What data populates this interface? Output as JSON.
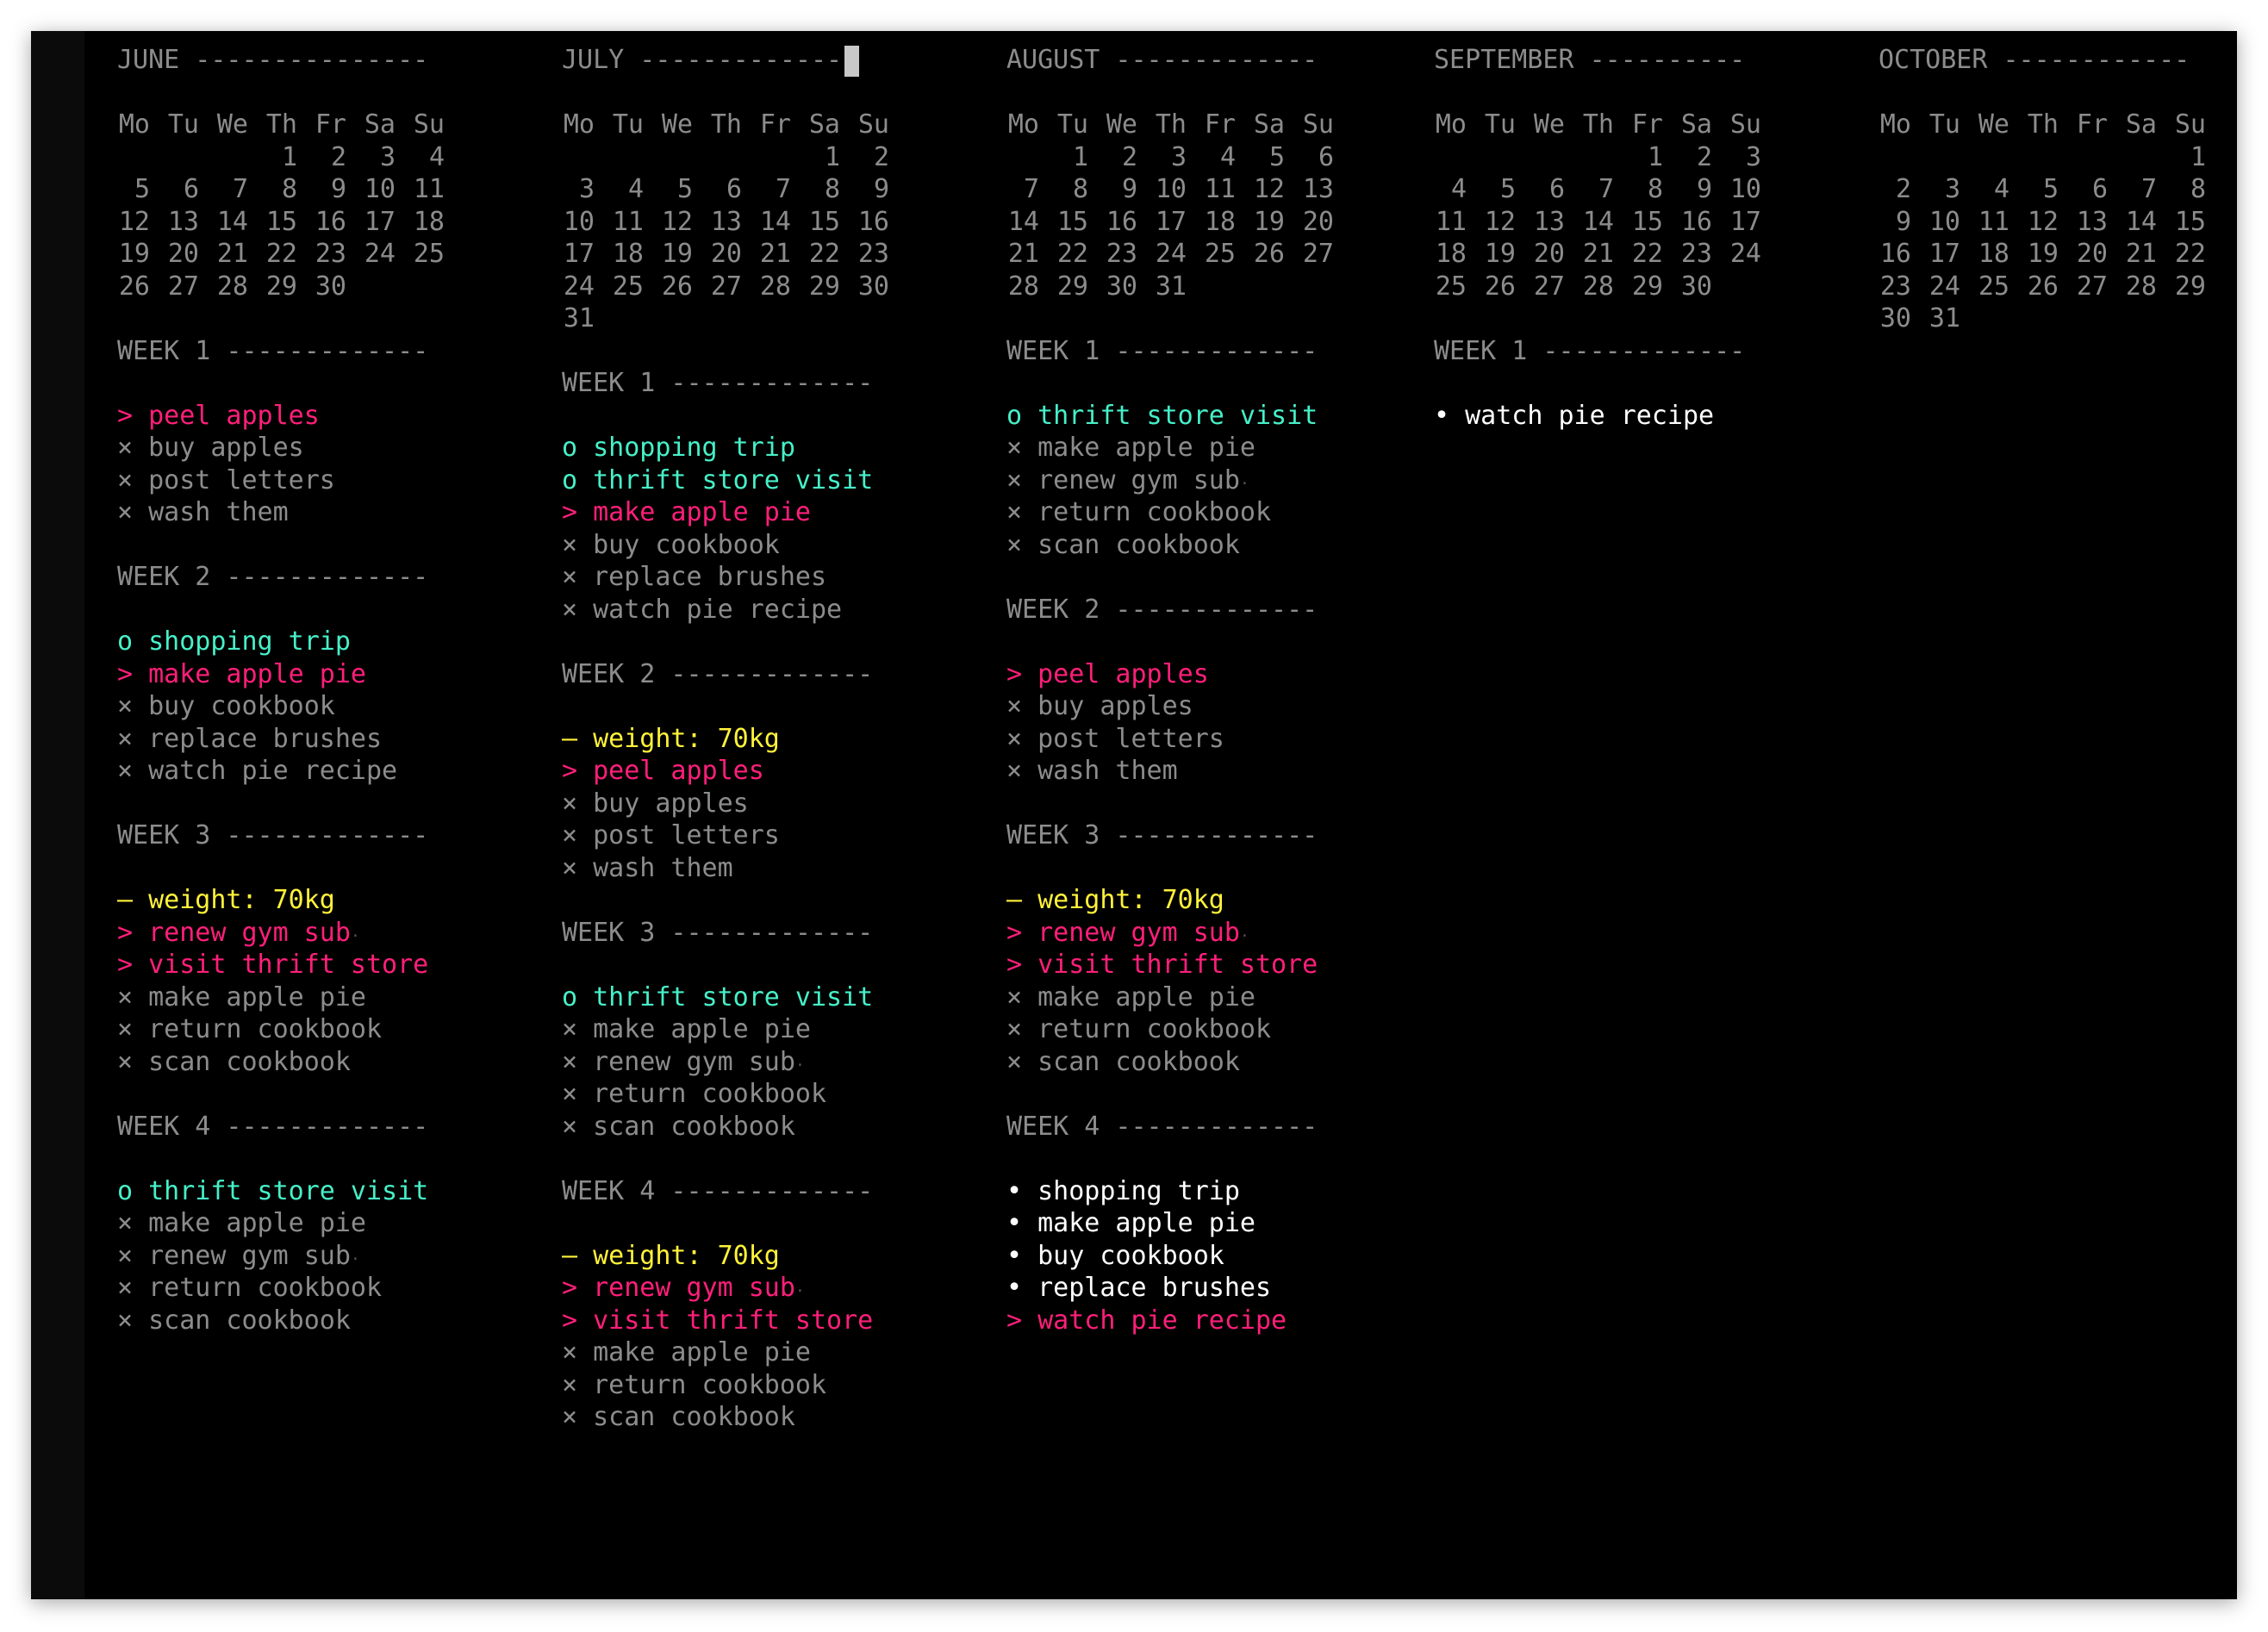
{
  "colors": {
    "background": "#000000",
    "muted": "#8c8c8c",
    "migrated": "#ff1f7a",
    "event": "#46f0c8",
    "note": "#fff23a",
    "task": "#ffffff"
  },
  "months": [
    {
      "header": "JUNE ---------------",
      "days_header": [
        "Mo",
        "Tu",
        "We",
        "Th",
        "Fr",
        "Sa",
        "Su"
      ],
      "weeks": [
        [
          "",
          "",
          "",
          "1",
          "2",
          "3",
          "4"
        ],
        [
          "5",
          "6",
          "7",
          "8",
          "9",
          "10",
          "11"
        ],
        [
          "12",
          "13",
          "14",
          "15",
          "16",
          "17",
          "18"
        ],
        [
          "19",
          "20",
          "21",
          "22",
          "23",
          "24",
          "25"
        ],
        [
          "26",
          "27",
          "28",
          "29",
          "30",
          "",
          ""
        ]
      ],
      "log": [
        {
          "header": "WEEK 1 -------------",
          "items": [
            {
              "type": "migrated",
              "marker": ">",
              "text": "peel apples"
            },
            {
              "type": "done",
              "marker": "×",
              "text": "buy apples"
            },
            {
              "type": "done",
              "marker": "×",
              "text": "post letters"
            },
            {
              "type": "done",
              "marker": "×",
              "text": "wash them"
            }
          ]
        },
        {
          "header": "WEEK 2 -------------",
          "items": [
            {
              "type": "event",
              "marker": "o",
              "text": "shopping trip"
            },
            {
              "type": "migrated",
              "marker": ">",
              "text": "make apple pie"
            },
            {
              "type": "done",
              "marker": "×",
              "text": "buy cookbook"
            },
            {
              "type": "done",
              "marker": "×",
              "text": "replace brushes"
            },
            {
              "type": "done",
              "marker": "×",
              "text": "watch pie recipe"
            }
          ]
        },
        {
          "header": "WEEK 3 -------------",
          "items": [
            {
              "type": "note",
              "marker": "–",
              "text": "weight: 70kg"
            },
            {
              "type": "migrated",
              "marker": ">",
              "text": "renew gym sub",
              "dot": true
            },
            {
              "type": "migrated",
              "marker": ">",
              "text": "visit thrift store"
            },
            {
              "type": "done",
              "marker": "×",
              "text": "make apple pie"
            },
            {
              "type": "done",
              "marker": "×",
              "text": "return cookbook"
            },
            {
              "type": "done",
              "marker": "×",
              "text": "scan cookbook"
            }
          ]
        },
        {
          "header": "WEEK 4 -------------",
          "items": [
            {
              "type": "event",
              "marker": "o",
              "text": "thrift store visit"
            },
            {
              "type": "done",
              "marker": "×",
              "text": "make apple pie"
            },
            {
              "type": "done",
              "marker": "×",
              "text": "renew gym sub",
              "dot": true
            },
            {
              "type": "done",
              "marker": "×",
              "text": "return cookbook"
            },
            {
              "type": "done",
              "marker": "×",
              "text": "scan cookbook"
            }
          ]
        }
      ]
    },
    {
      "header": "JULY -------------- ",
      "days_header": [
        "Mo",
        "Tu",
        "We",
        "Th",
        "Fr",
        "Sa",
        "Su"
      ],
      "weeks": [
        [
          "",
          "",
          "",
          "",
          "",
          "1",
          "2"
        ],
        [
          "3",
          "4",
          "5",
          "6",
          "7",
          "8",
          "9"
        ],
        [
          "10",
          "11",
          "12",
          "13",
          "14",
          "15",
          "16"
        ],
        [
          "17",
          "18",
          "19",
          "20",
          "21",
          "22",
          "23"
        ],
        [
          "24",
          "25",
          "26",
          "27",
          "28",
          "29",
          "30"
        ],
        [
          "31",
          "",
          "",
          "",
          "",
          "",
          ""
        ]
      ],
      "log": [
        {
          "header": "WEEK 1 -------------",
          "items": [
            {
              "type": "event",
              "marker": "o",
              "text": "shopping trip"
            },
            {
              "type": "event",
              "marker": "o",
              "text": "thrift store visit"
            },
            {
              "type": "migrated",
              "marker": ">",
              "text": "make apple pie"
            },
            {
              "type": "done",
              "marker": "×",
              "text": "buy cookbook"
            },
            {
              "type": "done",
              "marker": "×",
              "text": "replace brushes"
            },
            {
              "type": "done",
              "marker": "×",
              "text": "watch pie recipe"
            }
          ]
        },
        {
          "header": "WEEK 2 -------------",
          "items": [
            {
              "type": "note",
              "marker": "–",
              "text": "weight: 70kg"
            },
            {
              "type": "migrated",
              "marker": ">",
              "text": "peel apples"
            },
            {
              "type": "done",
              "marker": "×",
              "text": "buy apples"
            },
            {
              "type": "done",
              "marker": "×",
              "text": "post letters"
            },
            {
              "type": "done",
              "marker": "×",
              "text": "wash them"
            }
          ]
        },
        {
          "header": "WEEK 3 -------------",
          "items": [
            {
              "type": "event",
              "marker": "o",
              "text": "thrift store visit"
            },
            {
              "type": "done",
              "marker": "×",
              "text": "make apple pie"
            },
            {
              "type": "done",
              "marker": "×",
              "text": "renew gym sub",
              "dot": true
            },
            {
              "type": "done",
              "marker": "×",
              "text": "return cookbook"
            },
            {
              "type": "done",
              "marker": "×",
              "text": "scan cookbook"
            }
          ]
        },
        {
          "header": "WEEK 4 -------------",
          "items": [
            {
              "type": "note",
              "marker": "–",
              "text": "weight: 70kg"
            },
            {
              "type": "migrated",
              "marker": ">",
              "text": "renew gym sub",
              "dot": true
            },
            {
              "type": "migrated",
              "marker": ">",
              "text": "visit thrift store"
            },
            {
              "type": "done",
              "marker": "×",
              "text": "make apple pie"
            },
            {
              "type": "done",
              "marker": "×",
              "text": "return cookbook"
            },
            {
              "type": "done",
              "marker": "×",
              "text": "scan cookbook"
            }
          ]
        }
      ]
    },
    {
      "header": "AUGUST -------------",
      "days_header": [
        "Mo",
        "Tu",
        "We",
        "Th",
        "Fr",
        "Sa",
        "Su"
      ],
      "weeks": [
        [
          "",
          "1",
          "2",
          "3",
          "4",
          "5",
          "6"
        ],
        [
          "7",
          "8",
          "9",
          "10",
          "11",
          "12",
          "13"
        ],
        [
          "14",
          "15",
          "16",
          "17",
          "18",
          "19",
          "20"
        ],
        [
          "21",
          "22",
          "23",
          "24",
          "25",
          "26",
          "27"
        ],
        [
          "28",
          "29",
          "30",
          "31",
          "",
          "",
          ""
        ]
      ],
      "log": [
        {
          "header": "WEEK 1 -------------",
          "items": [
            {
              "type": "event",
              "marker": "o",
              "text": "thrift store visit"
            },
            {
              "type": "done",
              "marker": "×",
              "text": "make apple pie"
            },
            {
              "type": "done",
              "marker": "×",
              "text": "renew gym sub",
              "dot": true
            },
            {
              "type": "done",
              "marker": "×",
              "text": "return cookbook"
            },
            {
              "type": "done",
              "marker": "×",
              "text": "scan cookbook"
            }
          ]
        },
        {
          "header": "WEEK 2 -------------",
          "items": [
            {
              "type": "migrated",
              "marker": ">",
              "text": "peel apples"
            },
            {
              "type": "done",
              "marker": "×",
              "text": "buy apples"
            },
            {
              "type": "done",
              "marker": "×",
              "text": "post letters"
            },
            {
              "type": "done",
              "marker": "×",
              "text": "wash them"
            }
          ]
        },
        {
          "header": "WEEK 3 -------------",
          "items": [
            {
              "type": "note",
              "marker": "–",
              "text": "weight: 70kg"
            },
            {
              "type": "migrated",
              "marker": ">",
              "text": "renew gym sub",
              "dot": true
            },
            {
              "type": "migrated",
              "marker": ">",
              "text": "visit thrift store"
            },
            {
              "type": "done",
              "marker": "×",
              "text": "make apple pie"
            },
            {
              "type": "done",
              "marker": "×",
              "text": "return cookbook"
            },
            {
              "type": "done",
              "marker": "×",
              "text": "scan cookbook"
            }
          ]
        },
        {
          "header": "WEEK 4 -------------",
          "items": [
            {
              "type": "task",
              "marker": "•",
              "text": "shopping trip"
            },
            {
              "type": "task",
              "marker": "•",
              "text": "make apple pie"
            },
            {
              "type": "task",
              "marker": "•",
              "text": "buy cookbook"
            },
            {
              "type": "task",
              "marker": "•",
              "text": "replace brushes"
            },
            {
              "type": "migrated",
              "marker": ">",
              "text": "watch pie recipe"
            }
          ]
        }
      ]
    },
    {
      "header": "SEPTEMBER ----------",
      "days_header": [
        "Mo",
        "Tu",
        "We",
        "Th",
        "Fr",
        "Sa",
        "Su"
      ],
      "weeks": [
        [
          "",
          "",
          "",
          "",
          "1",
          "2",
          "3"
        ],
        [
          "4",
          "5",
          "6",
          "7",
          "8",
          "9",
          "10"
        ],
        [
          "11",
          "12",
          "13",
          "14",
          "15",
          "16",
          "17"
        ],
        [
          "18",
          "19",
          "20",
          "21",
          "22",
          "23",
          "24"
        ],
        [
          "25",
          "26",
          "27",
          "28",
          "29",
          "30",
          ""
        ]
      ],
      "log": [
        {
          "header": "WEEK 1 -------------",
          "items": [
            {
              "type": "task",
              "marker": "•",
              "text": "watch pie recipe"
            }
          ]
        }
      ]
    },
    {
      "header": "OCTOBER ------------",
      "days_header": [
        "Mo",
        "Tu",
        "We",
        "Th",
        "Fr",
        "Sa",
        "Su"
      ],
      "weeks": [
        [
          "",
          "",
          "",
          "",
          "",
          "",
          "1"
        ],
        [
          "2",
          "3",
          "4",
          "5",
          "6",
          "7",
          "8"
        ],
        [
          "9",
          "10",
          "11",
          "12",
          "13",
          "14",
          "15"
        ],
        [
          "16",
          "17",
          "18",
          "19",
          "20",
          "21",
          "22"
        ],
        [
          "23",
          "24",
          "25",
          "26",
          "27",
          "28",
          "29"
        ],
        [
          "30",
          "31",
          "",
          "",
          "",
          "",
          ""
        ]
      ],
      "log": []
    }
  ]
}
